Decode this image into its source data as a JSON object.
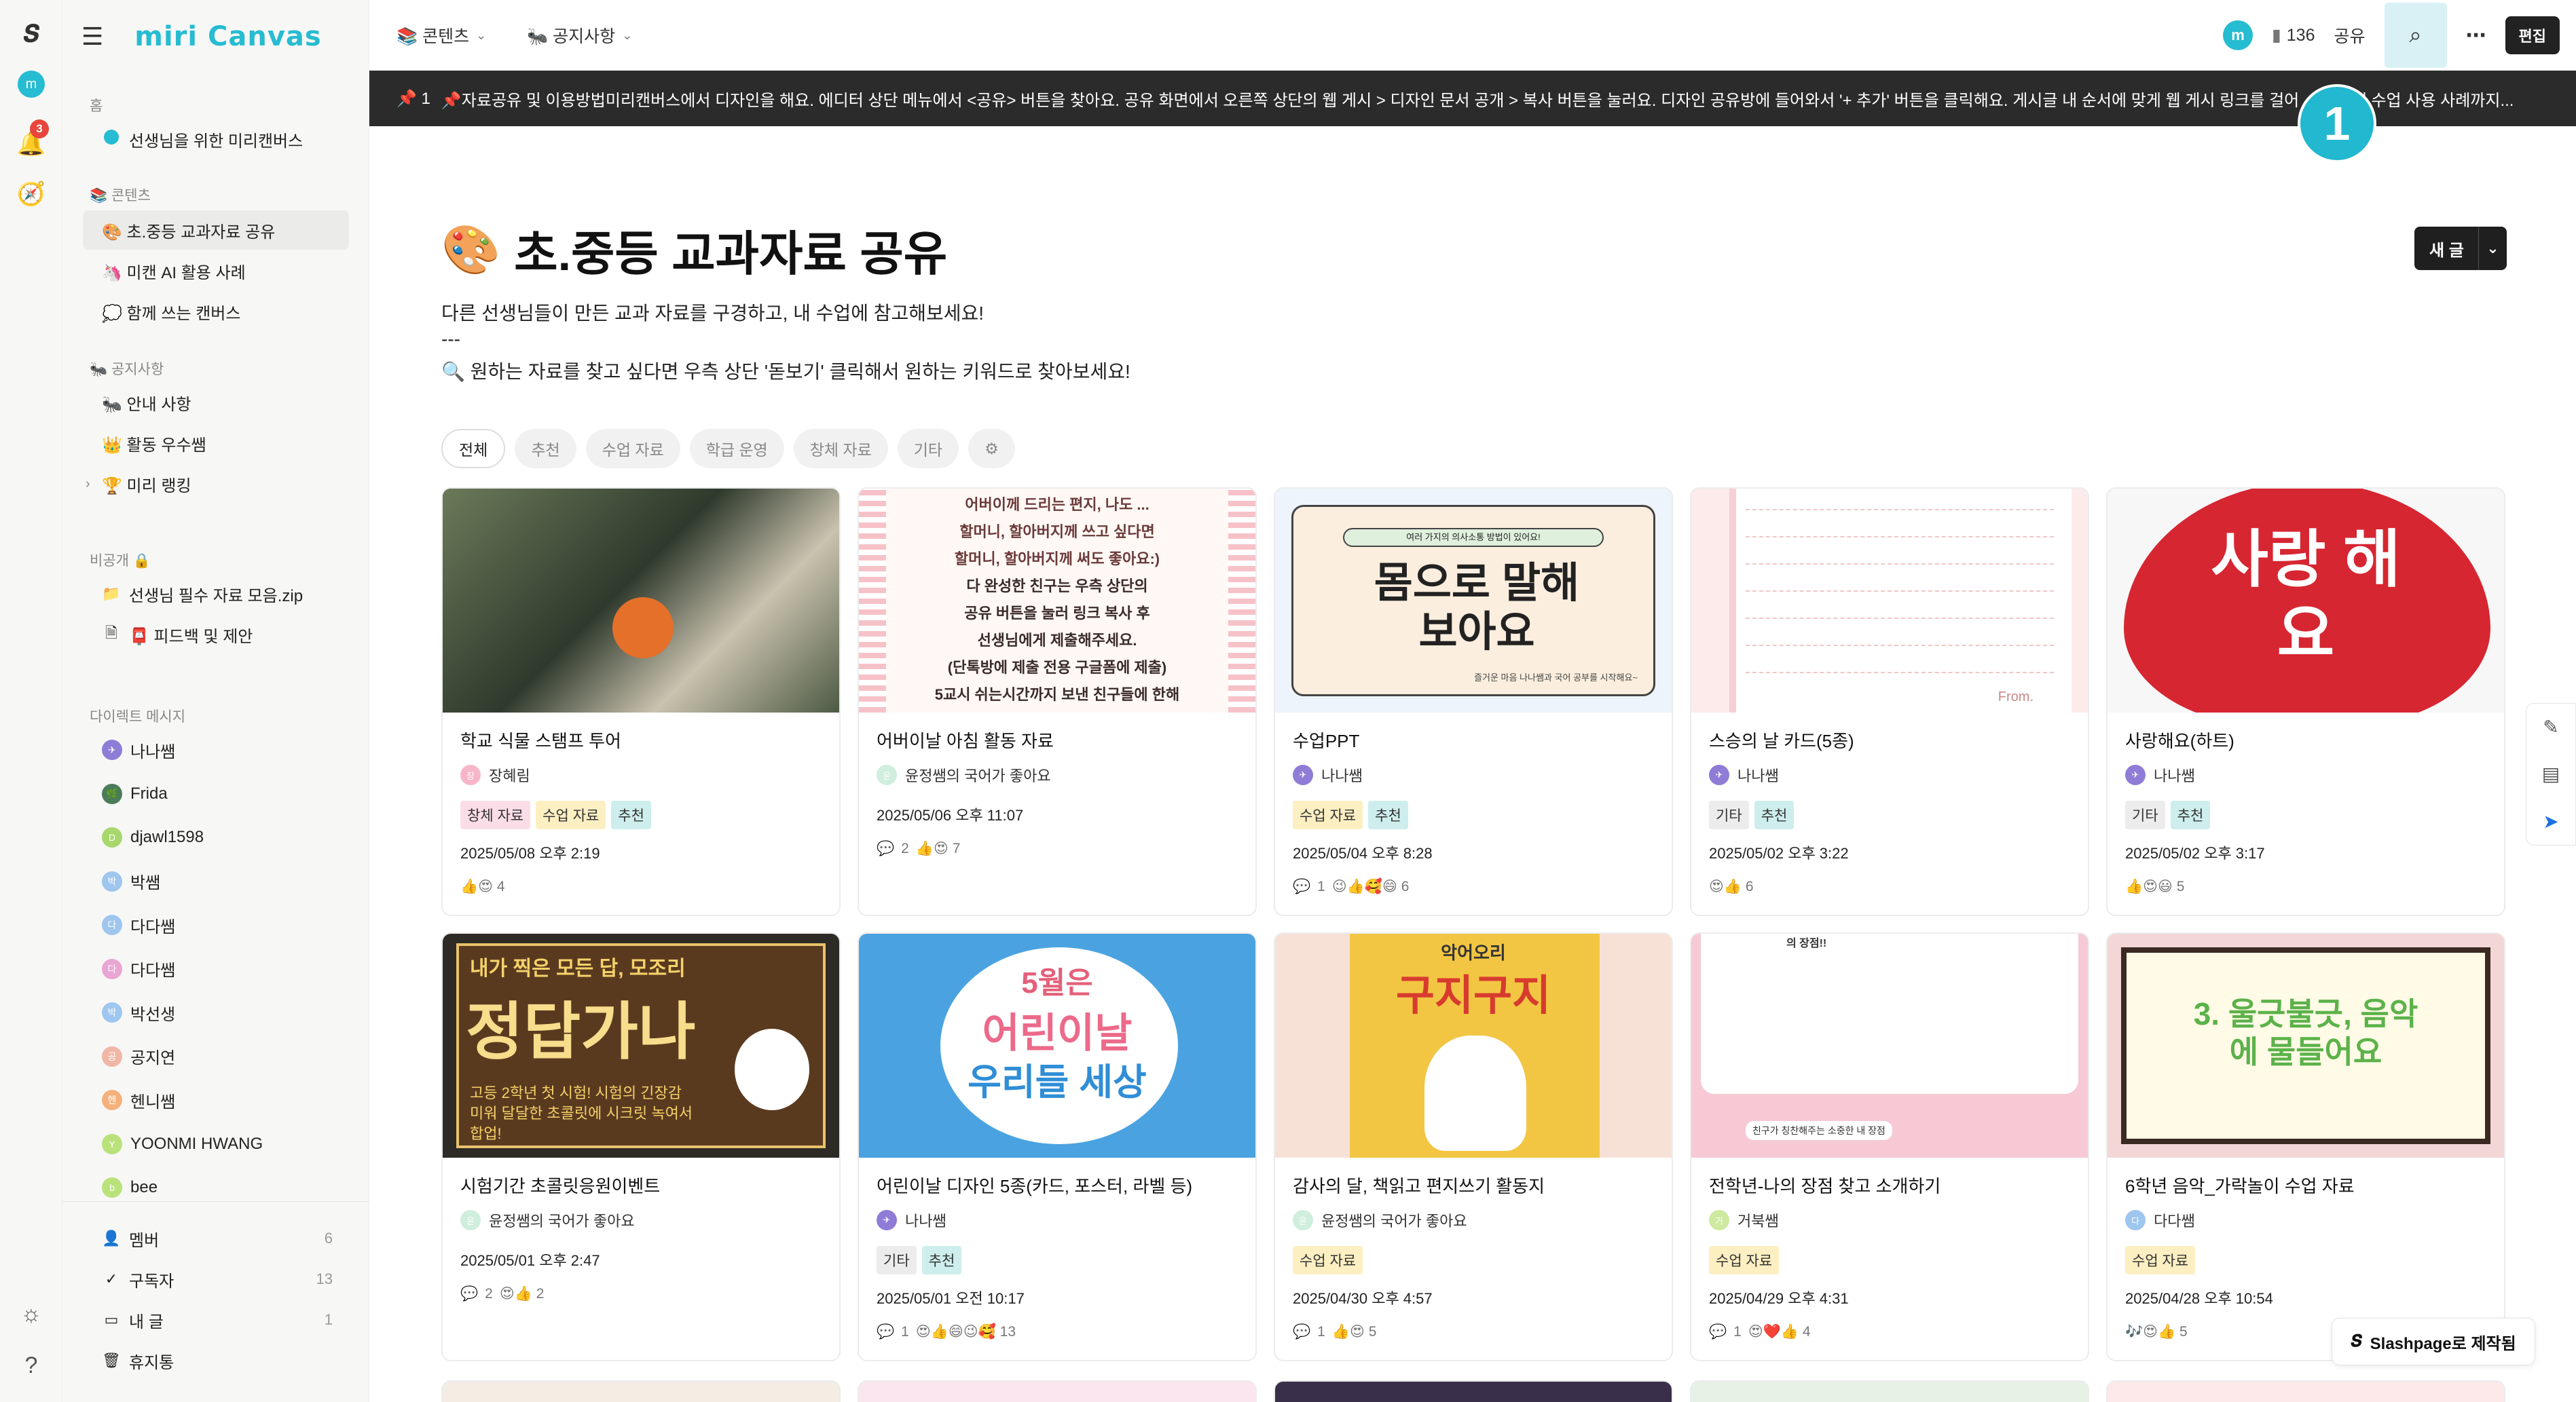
{
  "app": {
    "brand": "miri Canvas"
  },
  "sidebar": {
    "home_label": "홈",
    "home_item": "선생님을 위한 미리캔버스",
    "contents_label": "📚 콘텐츠",
    "contents_items": [
      "🎨 초.중등 교과자료 공유",
      "🦄 미캔 AI 활용 사례",
      "💭 함께 쓰는 캔버스"
    ],
    "notice_label": "🐜 공지사항",
    "notice_items": [
      "🐜 안내 사항",
      "👑 활동 우수쌤",
      "🏆 미리 랭킹"
    ],
    "private_label": "비공개 🔒",
    "private_items": [
      "선생님 필수 자료 모음.zip",
      "📮 피드백 및 제안"
    ],
    "dm_label": "다이렉트 메시지",
    "dm_users": [
      "나나쌤",
      "Frida",
      "djawl1598",
      "박쌤",
      "다다쌤",
      "다다쌤",
      "박선생",
      "공지연",
      "헨니쌤",
      "YOONMI HWANG",
      "bee"
    ],
    "bottom": [
      {
        "label": "멤버",
        "count": "6"
      },
      {
        "label": "구독자",
        "count": "13"
      },
      {
        "label": "내 글",
        "count": "1"
      },
      {
        "label": "휴지통",
        "count": ""
      }
    ]
  },
  "rail": {
    "notification_count": "3"
  },
  "topbar": {
    "menu1": "📚 콘텐츠",
    "menu2": "🐜 공지사항",
    "views": "136",
    "share": "공유",
    "edit": "편집"
  },
  "notice": {
    "pin": "📌 1",
    "text": "📌자료공유 및 이용방법미리캔버스에서 디자인을 해요. 에디터 상단 메뉴에서 <공유> 버튼을 찾아요. 공유 화면에서 오른쪽 상단의 웹 게시 > 디자인 문서 공개 > 복사 버튼을 눌러요. 디자인 공유방에 들어와서 '+ 추가' 버튼을 클릭해요. 게시글 내 순서에 맞게 웹 게시 링크를 걸어 ... 단하게 수업 사용 사례까지..."
  },
  "step_marker": "1",
  "main": {
    "title": "초.중등 교과자료 공유",
    "desc1": "다른 선생님들이 만든 교과 자료를 구경하고, 내 수업에 참고해보세요!",
    "desc2": "---",
    "desc3": "🔍 원하는 자료를 찾고 싶다면 우측 상단 '돋보기' 클릭해서 원하는 키워드로 찾아보세요!",
    "new_post": "새 글",
    "filters": [
      "전체",
      "추천",
      "수업 자료",
      "학급 운영",
      "창체 자료",
      "기타"
    ]
  },
  "cards": [
    {
      "title": "학교 식물 스탬프 투어",
      "author": "장혜림",
      "tags": [
        "창체 자료",
        "수업 자료",
        "추천"
      ],
      "date": "2025/05/08 오후 2:19",
      "comments": "",
      "reactions": "👍😍 4"
    },
    {
      "title": "어버이날 아침 활동 자료",
      "author": "윤정쌤의 국어가 좋아요",
      "tags": [],
      "date": "2025/05/06 오후 11:07",
      "comments": "2",
      "reactions": "👍😍 7"
    },
    {
      "title": "수업PPT",
      "author": "나나쌤",
      "tags": [
        "수업 자료",
        "추천"
      ],
      "date": "2025/05/04 오후 8:28",
      "comments": "1",
      "reactions": "😉👍🥰😄 6"
    },
    {
      "title": "스승의 날 카드(5종)",
      "author": "나나쌤",
      "tags": [
        "기타",
        "추천"
      ],
      "date": "2025/05/02 오후 3:22",
      "comments": "",
      "reactions": "😍👍 6"
    },
    {
      "title": "사랑해요(하트)",
      "author": "나나쌤",
      "tags": [
        "기타",
        "추천"
      ],
      "date": "2025/05/02 오후 3:17",
      "comments": "",
      "reactions": "👍😍😃 5"
    },
    {
      "title": "시험기간 초콜릿응원이벤트",
      "author": "윤정쌤의 국어가 좋아요",
      "tags": [],
      "date": "2025/05/01 오후 2:47",
      "comments": "2",
      "reactions": "😍👍 2"
    },
    {
      "title": "어린이날 디자인 5종(카드, 포스터, 라벨 등)",
      "author": "나나쌤",
      "tags": [
        "기타",
        "추천"
      ],
      "date": "2025/05/01 오전 10:17",
      "comments": "1",
      "reactions": "😍👍😄😉🥰 13"
    },
    {
      "title": "감사의 달, 책읽고 편지쓰기 활동지",
      "author": "윤정쌤의 국어가 좋아요",
      "tags": [
        "수업 자료"
      ],
      "date": "2025/04/30 오후 4:57",
      "comments": "1",
      "reactions": "👍😍 5"
    },
    {
      "title": "전학년-나의 장점 찾고 소개하기",
      "author": "거북쌤",
      "tags": [
        "수업 자료"
      ],
      "date": "2025/04/29 오후 4:31",
      "comments": "1",
      "reactions": "😍❤️👍 4"
    },
    {
      "title": "6학년 음악_가락놀이 수업 자료",
      "author": "다다쌤",
      "tags": [
        "수업 자료"
      ],
      "date": "2025/04/28 오후 10:54",
      "comments": "",
      "reactions": "🎶😍👍 5"
    }
  ],
  "thumb_text": {
    "c2": [
      "어버이께 드리는 편지, 나도 ...",
      "할머니, 할아버지께 쓰고 싶다면",
      "할머니, 할아버지께 써도 좋아요:)",
      "다 완성한 친구는 우측 상단의",
      "공유 버튼을 눌러 링크 복사 후",
      "선생님에게 제출해주세요.",
      "(단톡방에 제출 전용 구글폼에 제출)",
      "5교시 쉬는시간까지 보낸 친구들에 한해"
    ],
    "c3_top": "여러 가지의 의사소통 방법이 있어요!",
    "c3_big": "몸으로 말해 보아요",
    "c3_bottom": "즐거운 마음 나나쌤과 국어 공부를 시작해요~",
    "c4": "From.",
    "c5": "사랑 해요",
    "c6_top": "내가 찍은 모든 답, 모조리",
    "c6_big": "정답가나",
    "c6_sub": "고등 2학년 첫 시험! 시험의 긴장감미워 달달한 초콜릿에 시크릿 녹여서 합업!",
    "c7_top": "5월은",
    "c7_mid": "어린이날",
    "c7_bot": "우리들 세상",
    "c8_top": "악어오리",
    "c8_big": "구지구지",
    "c9_top": "의 장점!!",
    "c9_bottom": "친구가 칭찬해주는 소중한 내 장점",
    "c10": "3. 울긋불긋, 음악에 물들어요"
  },
  "slashpage": "Slashpage로 제작됨",
  "colors": {
    "brand": "#26bcd1",
    "notice_bg": "#2b2b2b",
    "tag_pink": "#fbdde8",
    "tag_yellow": "#fcefc2",
    "tag_teal": "#cdeeec"
  }
}
